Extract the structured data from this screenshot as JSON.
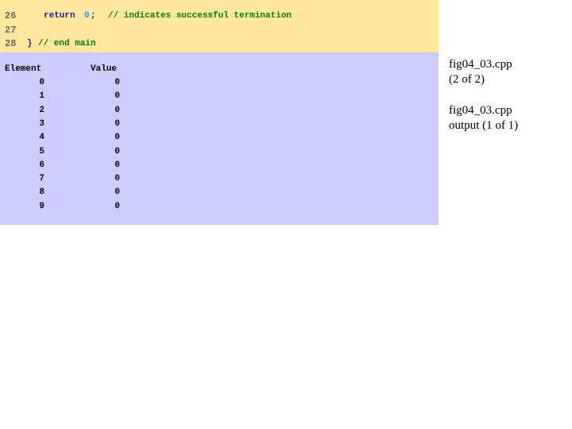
{
  "code": [
    {
      "num": "26",
      "keyword": "return",
      "value": "0",
      "punct": ";",
      "comment": "// indicates successful termination"
    },
    {
      "num": "27"
    },
    {
      "num": "28",
      "brace": "}",
      "comment": "// end main"
    }
  ],
  "output": {
    "headers": [
      "Element",
      "Value"
    ],
    "rows": [
      [
        "0",
        "0"
      ],
      [
        "1",
        "0"
      ],
      [
        "2",
        "0"
      ],
      [
        "3",
        "0"
      ],
      [
        "4",
        "0"
      ],
      [
        "5",
        "0"
      ],
      [
        "6",
        "0"
      ],
      [
        "7",
        "0"
      ],
      [
        "8",
        "0"
      ],
      [
        "9",
        "0"
      ]
    ]
  },
  "side": {
    "file1": "fig04_03.cpp",
    "page1": "(2 of 2)",
    "file2": "fig04_03.cpp",
    "page2": "output (1 of 1)"
  },
  "colors": {
    "code_bg": "#FFE89E",
    "output_bg": "#CCCCFF",
    "keyword": "#1a1a8c",
    "number": "#3399ff",
    "comment": "#008000"
  }
}
